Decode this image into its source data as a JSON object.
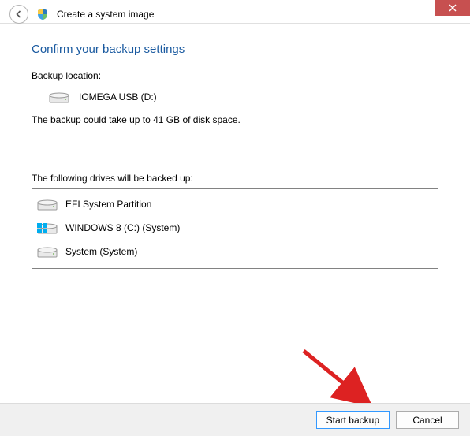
{
  "window": {
    "title": "Create a system image"
  },
  "page": {
    "heading": "Confirm your backup settings",
    "backup_location_label": "Backup location:",
    "backup_location_value": "IOMEGA USB (D:)",
    "space_note": "The backup could take up to 41 GB of disk space.",
    "drives_label": "The following drives will be backed up:",
    "drives": [
      {
        "name": "EFI System Partition"
      },
      {
        "name": "WINDOWS 8 (C:) (System)"
      },
      {
        "name": "System (System)"
      }
    ]
  },
  "buttons": {
    "start": "Start backup",
    "cancel": "Cancel"
  }
}
